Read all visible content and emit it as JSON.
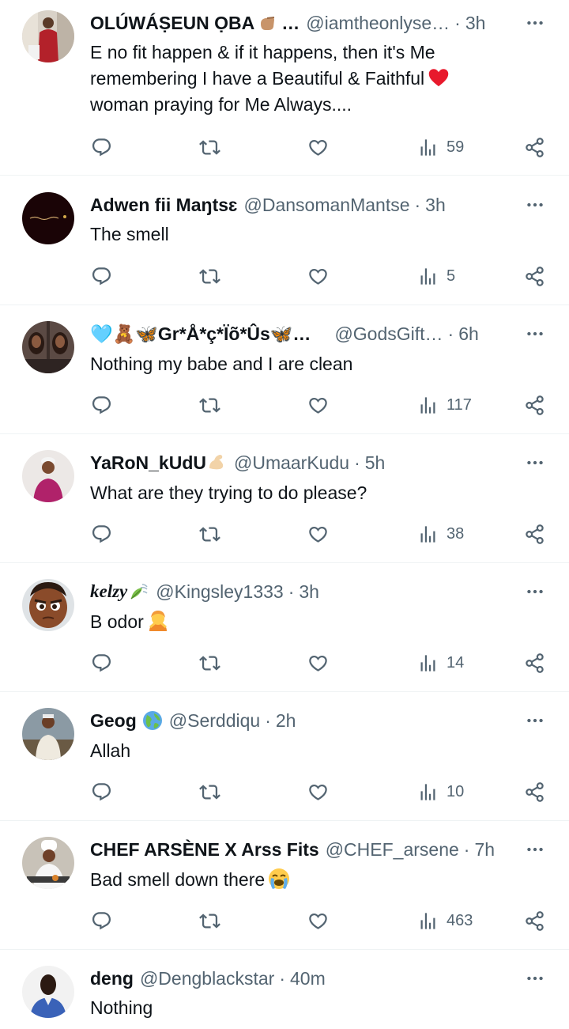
{
  "colors": {
    "text": "#0f1419",
    "muted": "#536471",
    "divider": "#eff3f4",
    "heart": "#e8192c"
  },
  "tweets": [
    {
      "name": "OLÚWÁṢEUN ỌBA",
      "name_emoji": "pointing-hand-emoji",
      "name_suffix": "…",
      "handle": "@iamtheonlyse…",
      "time": "3h",
      "text_lines": [
        "E no fit happen & if it happens, then it's Me",
        "remembering I have a Beautiful & Faithful",
        "woman praying for Me Always...."
      ],
      "text_emoji": "red-heart-emoji",
      "views": "59",
      "avatar": "man-in-red-avatar"
    },
    {
      "name": "Adwen fii Maŋtsɛ",
      "handle": "@DansomanMantse",
      "time": "3h",
      "text": "The smell",
      "views": "5",
      "avatar": "dark-logo-avatar"
    },
    {
      "name": "🩵🧸🦋Gr*Å*ç*Ïõ*Ûs🦋…",
      "handle": "@GodsGift…",
      "time": "6h",
      "text": "Nothing my babe and I are clean",
      "views": "117",
      "avatar": "woman-mirror-avatar"
    },
    {
      "name": "YaRoN_kUdU",
      "name_emoji": "flexed-biceps-emoji",
      "handle": "@UmaarKudu",
      "time": "5h",
      "text": "What are they trying to do please?",
      "views": "38",
      "avatar": "man-pink-avatar"
    },
    {
      "name": "kelzy",
      "name_emoji": "leaf-wind-emoji",
      "handle": "@Kingsley1333",
      "time": "3h",
      "text": "B odor",
      "text_emoji": "person-gesturing-no-emoji",
      "views": "14",
      "avatar": "cartoon-face-avatar"
    },
    {
      "name": "Geog",
      "name_emoji": "globe-emoji",
      "handle": "@Serddiqu",
      "time": "2h",
      "text": "Allah",
      "views": "10",
      "avatar": "man-white-robe-avatar"
    },
    {
      "name": "CHEF ARSÈNE X Arss Fits",
      "handle": "@CHEF_arsene",
      "time": "7h",
      "text": "Bad smell down there",
      "text_emoji": "loudly-crying-emoji",
      "views": "463",
      "avatar": "chef-avatar"
    },
    {
      "name": "deng",
      "handle": "@Dengblackstar",
      "time": "40m",
      "text": "Nothing",
      "avatar": "man-blue-shirt-avatar"
    }
  ],
  "separator": "·"
}
